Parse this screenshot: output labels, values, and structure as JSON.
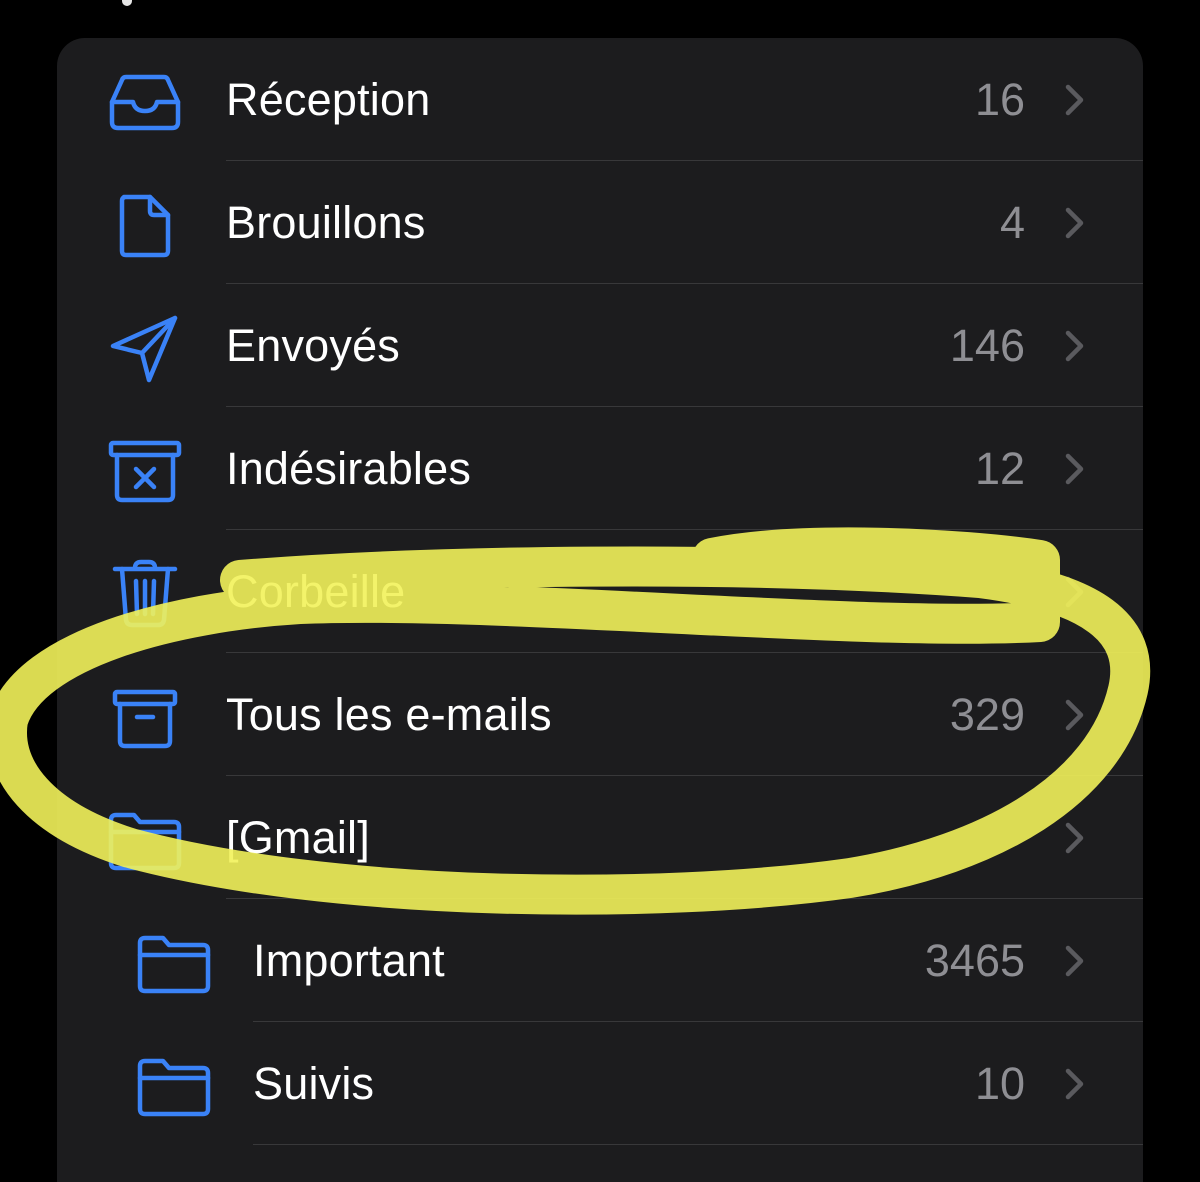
{
  "mailboxes": [
    {
      "label": "Réception",
      "count": "16",
      "icon": "inbox-icon"
    },
    {
      "label": "Brouillons",
      "count": "4",
      "icon": "document-icon"
    },
    {
      "label": "Envoyés",
      "count": "146",
      "icon": "paper-plane-icon"
    },
    {
      "label": "Indésirables",
      "count": "12",
      "icon": "junk-bin-icon"
    },
    {
      "label": "Corbeille",
      "count": "",
      "icon": "trash-icon"
    },
    {
      "label": "Tous les e-mails",
      "count": "329",
      "icon": "archive-icon"
    },
    {
      "label": "[Gmail]",
      "count": "",
      "icon": "folder-icon"
    },
    {
      "label": "Important",
      "count": "3465",
      "icon": "folder-icon"
    },
    {
      "label": "Suivis",
      "count": "10",
      "icon": "folder-icon"
    }
  ],
  "colors": {
    "accent": "#3a82f7",
    "background": "#000000",
    "card": "#1c1c1e",
    "separator": "#38383a",
    "label": "#ffffff",
    "count": "#8e8e93",
    "chevron": "#5a5a5e",
    "highlighter": "#f2f25a"
  }
}
